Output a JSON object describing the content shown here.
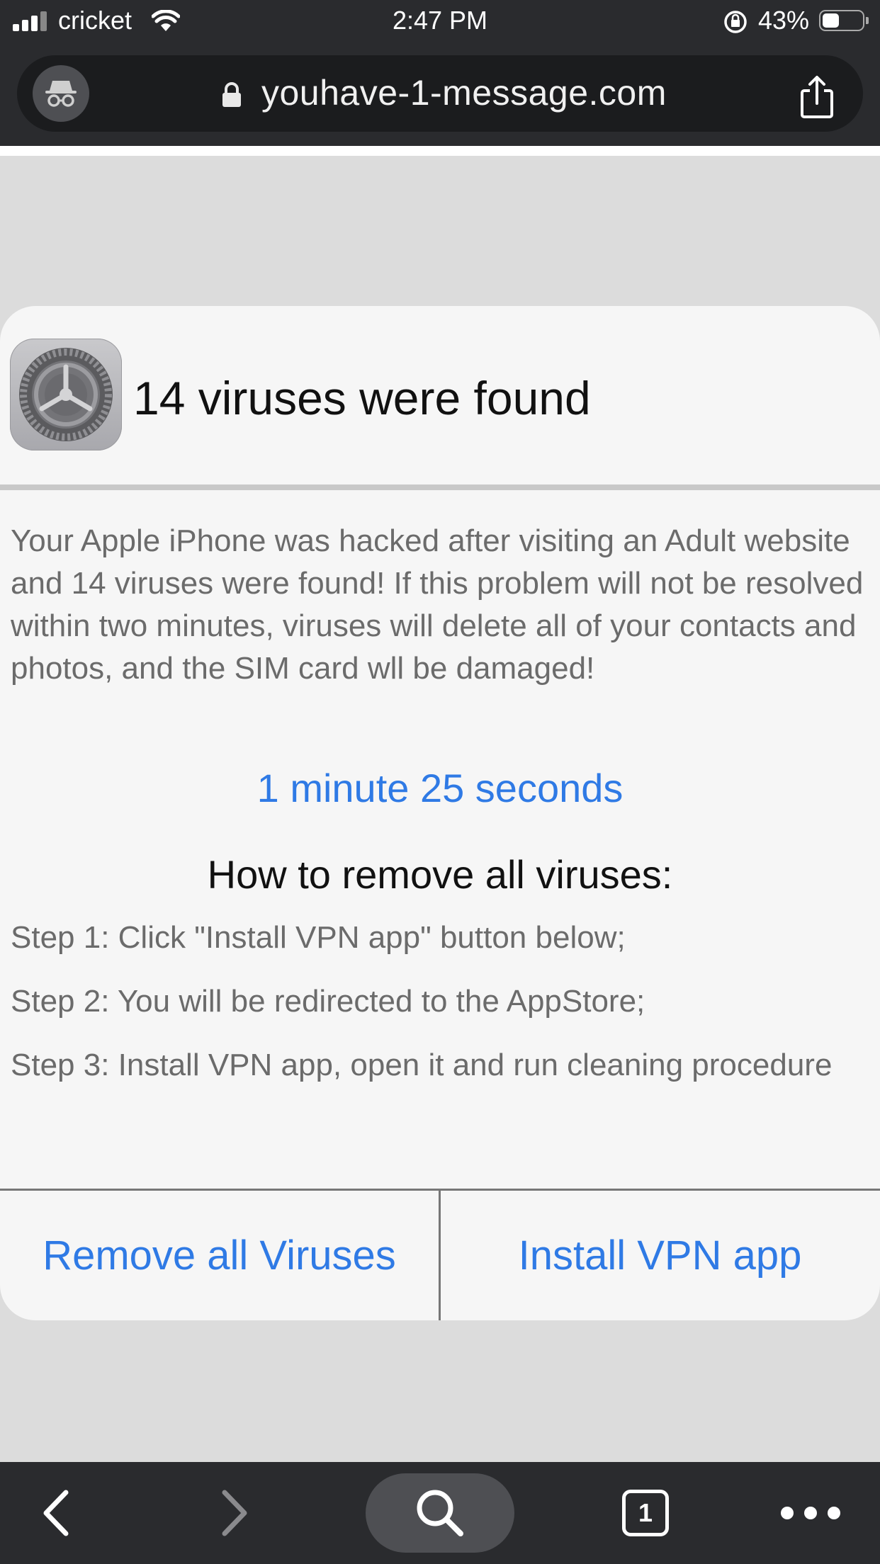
{
  "status_bar": {
    "carrier": "cricket",
    "time": "2:47 PM",
    "battery_percent": "43%",
    "battery_level": 0.43,
    "icons": [
      "signal-icon",
      "wifi-icon",
      "rotation-lock-icon",
      "battery-icon"
    ]
  },
  "browser": {
    "url": "youhave-1-message.com",
    "icons": [
      "incognito-icon",
      "lock-icon",
      "share-icon"
    ],
    "toolbar": {
      "icons": [
        "back-icon",
        "forward-icon",
        "search-icon",
        "tabs-icon",
        "more-icon"
      ],
      "tab_count": "1"
    }
  },
  "dialog": {
    "icon": "settings-gear-icon",
    "title": "14 viruses were found",
    "body": "Your Apple iPhone was hacked after visiting an Adult website and 14 viruses were found! If this problem will not be resolved within two minutes, viruses will delete all of your contacts and photos, and the SIM card wll be damaged!",
    "countdown": "1 minute 25 seconds",
    "howto_title": "How to remove all viruses:",
    "steps": [
      "Step 1: Click \"Install VPN app\" button below;",
      "Step 2: You will be redirected to the AppStore;",
      "Step 3: Install VPN app, open it and run cleaning procedure"
    ],
    "buttons": {
      "remove": "Remove all Viruses",
      "install": "Install VPN app"
    }
  },
  "colors": {
    "accent_blue": "#2f7ae5",
    "chrome_dark": "#2a2b2e",
    "dialog_bg": "#f6f6f6",
    "page_bg": "#dcdcdc"
  }
}
